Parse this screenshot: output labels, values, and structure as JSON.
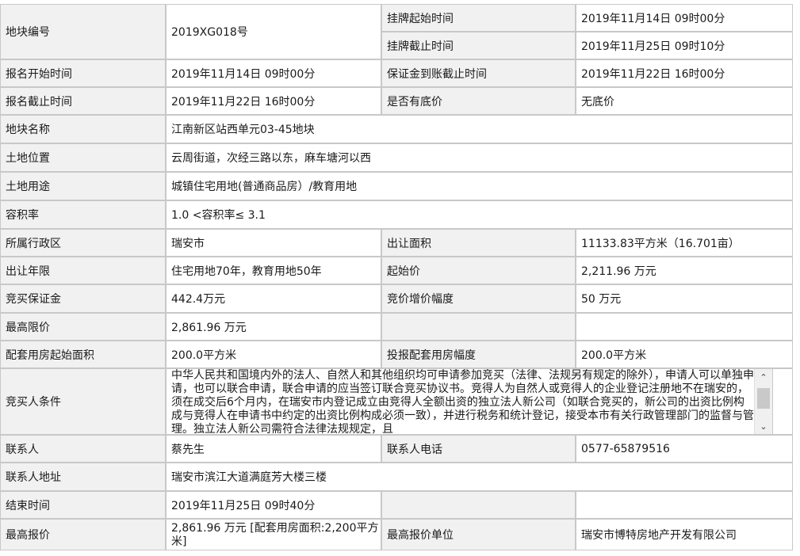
{
  "fields": {
    "parcel_no_label": "地块编号",
    "parcel_no": "2019XG018号",
    "listing_start_label": "挂牌起始时间",
    "listing_start": "2019年11月14日 09时00分",
    "listing_end_label": "挂牌截止时间",
    "listing_end": "2019年11月25日 09时10分",
    "reg_start_label": "报名开始时间",
    "reg_start": "2019年11月14日 09时00分",
    "deposit_deadline_label": "保证金到账截止时间",
    "deposit_deadline": "2019年11月22日 16时00分",
    "reg_end_label": "报名截止时间",
    "reg_end": "2019年11月22日 16时00分",
    "reserve_label": "是否有底价",
    "reserve": "无底价",
    "name_label": "地块名称",
    "name": "江南新区站西单元03-45地块",
    "location_label": "土地位置",
    "location": "云周街道，次经三路以东，麻车塘河以西",
    "usage_label": "土地用途",
    "usage": "城镇住宅用地(普通商品房）/教育用地",
    "far_label": "容积率",
    "far": "1.0 <容积率≤ 3.1",
    "district_label": "所属行政区",
    "district": "瑞安市",
    "area_label": "出让面积",
    "area": "11133.83平方米（16.701亩）",
    "term_label": "出让年限",
    "term": "住宅用地70年，教育用地50年",
    "start_price_label": "起始价",
    "start_price": "2,211.96 万元",
    "bid_deposit_label": "竞买保证金",
    "bid_deposit": "442.4万元",
    "increment_label": "竞价增价幅度",
    "increment": "50 万元",
    "max_price_label": "最高限价",
    "max_price": "2,861.96 万元",
    "housing_start_label": "配套用房起始面积",
    "housing_start": "200.0平方米",
    "housing_step_label": "投报配套用房幅度",
    "housing_step": "200.0平方米",
    "bidder_cond_label": "竞买人条件",
    "bidder_cond": "中华人民共和国境内外的法人、自然人和其他组织均可申请参加竞买（法律、法规另有规定的除外），申请人可以单独申请，也可以联合申请，联合申请的应当签订联合竞买协议书。竞得人为自然人或竞得人的企业登记注册地不在瑞安的，须在成交后6个月内，在瑞安市内登记成立由竞得人全额出资的独立法人新公司（如联合竞买的，新公司的出资比例构成与竞得人在申请书中约定的出资比例构成必须一致），并进行税务和统计登记，接受本市有关行政管理部门的监督与管理。独立法人新公司需符合法律法规规定，且",
    "contact_label": "联系人",
    "contact": "蔡先生",
    "phone_label": "联系人电话",
    "phone": "0577-65879516",
    "address_label": "联系人地址",
    "address": "瑞安市滨江大道满庭芳大楼三楼",
    "end_time_label": "结束时间",
    "end_time": "2019年11月25日 09时40分",
    "top_bid_label": "最高报价",
    "top_bid": "2,861.96 万元 [配套用房面积:2,200平方米]",
    "top_bidder_label": "最高报价单位",
    "top_bidder": "瑞安市博特房地产开发有限公司"
  },
  "icons": {
    "scroll_up": "chevron-up-icon",
    "scroll_down": "chevron-down-icon"
  }
}
